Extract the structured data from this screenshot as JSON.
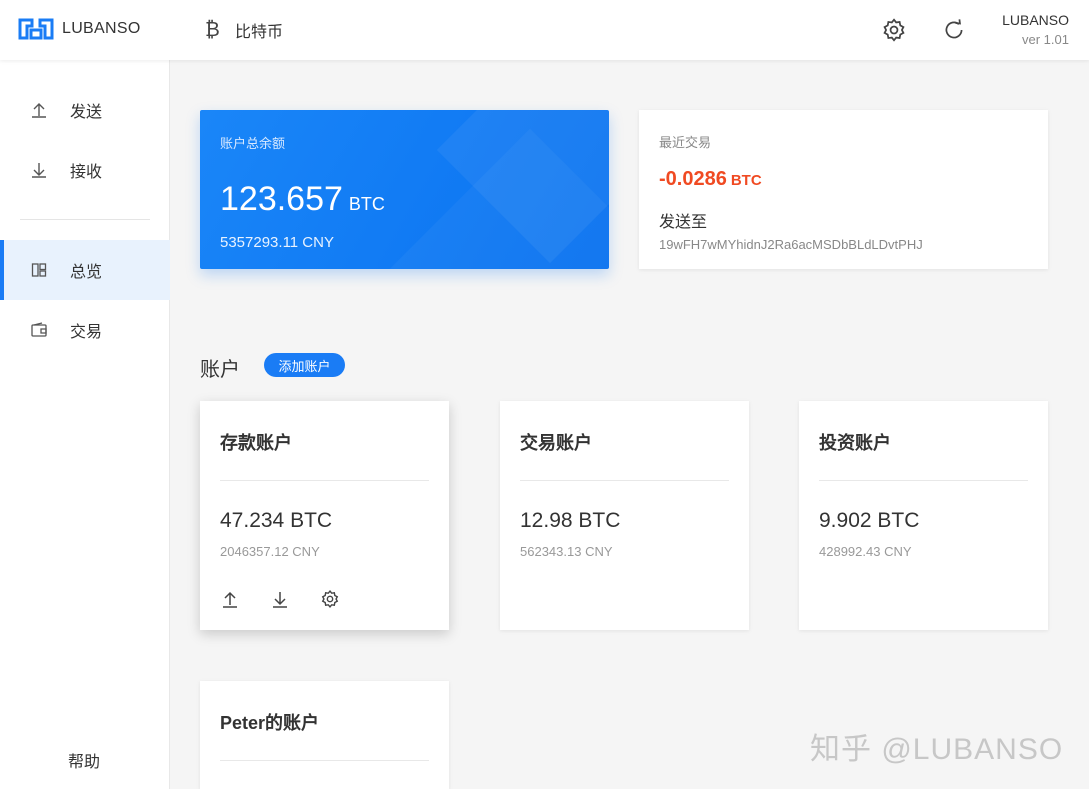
{
  "header": {
    "brand": "LUBANSO",
    "coin_symbol": "₿",
    "coin_name": "比特币",
    "brand_right": "LUBANSO",
    "version": "ver 1.01",
    "icons": [
      "gear-icon",
      "refresh-icon"
    ]
  },
  "sidebar": {
    "items": [
      {
        "label": "发送",
        "icon": "upload-icon"
      },
      {
        "label": "接收",
        "icon": "download-icon"
      },
      {
        "label": "总览",
        "icon": "overview-icon",
        "active": true
      },
      {
        "label": "交易",
        "icon": "wallet-icon"
      }
    ],
    "help": "帮助"
  },
  "balance": {
    "label": "账户总余额",
    "amount": "123.657",
    "unit": "BTC",
    "cny": "5357293.11 CNY"
  },
  "recent": {
    "label": "最近交易",
    "amount": "-0.0286",
    "unit": "BTC",
    "to_label": "发送至",
    "address": "19wFH7wMYhidnJ2Ra6acMSDbBLdLDvtPHJ"
  },
  "accounts": {
    "title": "账户",
    "add_label": "添加账户",
    "list": [
      {
        "name": "存款账户",
        "btc": "47.234 BTC",
        "cny": "2046357.12 CNY"
      },
      {
        "name": "交易账户",
        "btc": "12.98 BTC",
        "cny": "562343.13 CNY"
      },
      {
        "name": "投资账户",
        "btc": "9.902 BTC",
        "cny": "428992.43 CNY"
      },
      {
        "name": "Peter的账户"
      }
    ]
  },
  "watermark": "知乎 @LUBANSO",
  "colors": {
    "accent": "#1a7cf5",
    "negative": "#f04a22",
    "active_bg": "#e8f2fd"
  }
}
